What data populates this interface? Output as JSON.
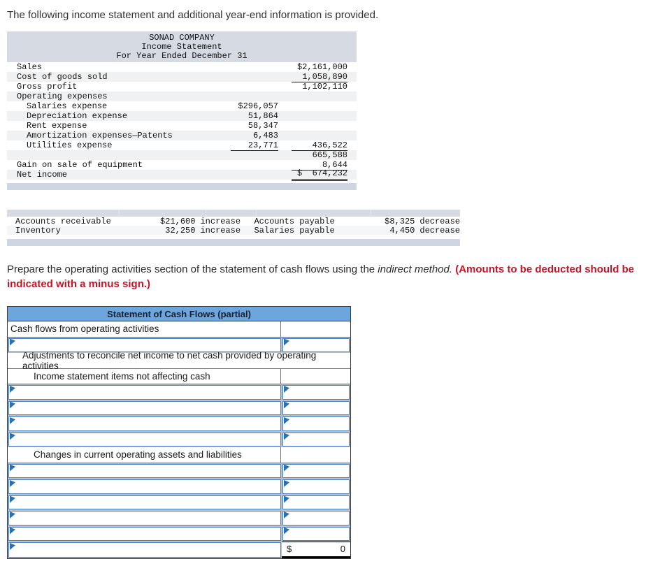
{
  "page": {
    "intro": "The following income statement and additional year-end information is provided."
  },
  "income_statement": {
    "title_lines": [
      "SONAD COMPANY",
      "Income Statement",
      "For Year Ended December 31"
    ],
    "rows": [
      {
        "label": "Sales",
        "c2": "",
        "c3": "$2,161,000"
      },
      {
        "label": "Cost of goods sold",
        "c2": "",
        "c3": "1,058,890"
      },
      {
        "label": "Gross profit",
        "c2": "",
        "c3": "1,102,110"
      },
      {
        "label": "Operating expenses",
        "c2": "",
        "c3": ""
      },
      {
        "label": "Salaries expense",
        "c2": "$296,057",
        "c3": ""
      },
      {
        "label": "Depreciation expense",
        "c2": "51,864",
        "c3": ""
      },
      {
        "label": "Rent expense",
        "c2": "58,347",
        "c3": ""
      },
      {
        "label": "Amortization expenses—Patents",
        "c2": "6,483",
        "c3": ""
      },
      {
        "label": "Utilities expense",
        "c2": "23,771",
        "c3": "436,522"
      },
      {
        "label": "",
        "c2": "",
        "c3": "665,588"
      },
      {
        "label": "Gain on sale of equipment",
        "c2": "",
        "c3": "8,644"
      },
      {
        "label": "Net income",
        "c2": "",
        "c3": "$  674,232"
      }
    ]
  },
  "additional_info": {
    "rows": [
      {
        "l_label": "Accounts receivable",
        "l_amount": "$21,600",
        "l_dir": "increase",
        "r_label": "Accounts payable",
        "r_amount": "$8,325",
        "r_dir": "decrease"
      },
      {
        "l_label": "Inventory",
        "l_amount": "32,250",
        "l_dir": "increase",
        "r_label": "Salaries payable",
        "r_amount": "4,450",
        "r_dir": "decrease"
      }
    ]
  },
  "instruction": {
    "text": "Prepare the operating activities section of the statement of cash flows using the ",
    "italic": "indirect method.",
    "red_bold": " (Amounts to be deducted should be indicated with a minus sign.)"
  },
  "cash_flow_statement": {
    "title": "Statement of Cash Flows (partial)",
    "section_label": "Cash flows from operating activities",
    "adjustments_label": "Adjustments to reconcile net income to net cash provided by operating activities",
    "income_items_label": "Income statement items not affecting cash",
    "changes_label": "Changes in current operating assets and liabilities",
    "total": {
      "currency": "$",
      "value": "0"
    }
  },
  "colors": {
    "table_header_blue": "#6ca6dd",
    "band_gray": "#d6dae3",
    "input_border_blue": "#4f81bd",
    "marker_blue": "#2e6fad",
    "warning_red": "#c41425"
  }
}
